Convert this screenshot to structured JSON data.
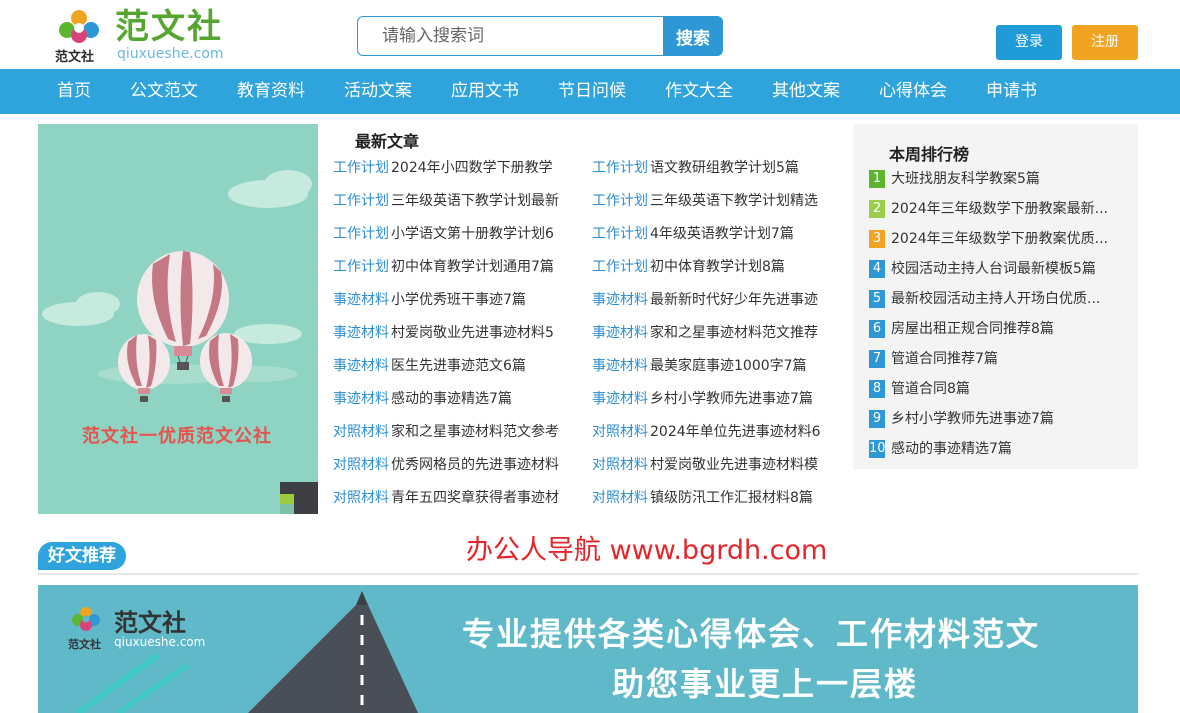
{
  "header": {
    "logo_cn": "范文社",
    "logo_small": "范文社",
    "logo_en": "qiuxueshe.com",
    "search_placeholder": "请输入搜索词",
    "search_btn": "搜索",
    "login": "登录",
    "register": "注册"
  },
  "nav": [
    "首页",
    "公文范文",
    "教育资料",
    "活动文案",
    "应用文书",
    "节日问候",
    "作文大全",
    "其他文案",
    "心得体会",
    "申请书"
  ],
  "hero": {
    "caption": "范文社一优质范文公社"
  },
  "latest": {
    "title": "最新文章",
    "left": [
      {
        "cat": "工作计划",
        "title": "2024年小四数学下册教学"
      },
      {
        "cat": "工作计划",
        "title": "三年级英语下教学计划最新"
      },
      {
        "cat": "工作计划",
        "title": "小学语文第十册教学计划6"
      },
      {
        "cat": "工作计划",
        "title": "初中体育教学计划通用7篇"
      },
      {
        "cat": "事迹材料",
        "title": "小学优秀班干事迹7篇"
      },
      {
        "cat": "事迹材料",
        "title": "村爱岗敬业先进事迹材料5"
      },
      {
        "cat": "事迹材料",
        "title": "医生先进事迹范文6篇"
      },
      {
        "cat": "事迹材料",
        "title": "感动的事迹精选7篇"
      },
      {
        "cat": "对照材料",
        "title": "家和之星事迹材料范文参考"
      },
      {
        "cat": "对照材料",
        "title": "优秀网格员的先进事迹材料"
      },
      {
        "cat": "对照材料",
        "title": "青年五四奖章获得者事迹材"
      }
    ],
    "right": [
      {
        "cat": "工作计划",
        "title": "语文教研组教学计划5篇"
      },
      {
        "cat": "工作计划",
        "title": "三年级英语下教学计划精选"
      },
      {
        "cat": "工作计划",
        "title": "4年级英语教学计划7篇"
      },
      {
        "cat": "工作计划",
        "title": "初中体育教学计划8篇"
      },
      {
        "cat": "事迹材料",
        "title": "最新新时代好少年先进事迹"
      },
      {
        "cat": "事迹材料",
        "title": "家和之星事迹材料范文推荐"
      },
      {
        "cat": "事迹材料",
        "title": "最美家庭事迹1000字7篇"
      },
      {
        "cat": "事迹材料",
        "title": "乡村小学教师先进事迹7篇"
      },
      {
        "cat": "对照材料",
        "title": "2024年单位先进事迹材料6"
      },
      {
        "cat": "对照材料",
        "title": "村爱岗敬业先进事迹材料模"
      },
      {
        "cat": "对照材料",
        "title": "镇级防汛工作汇报材料8篇"
      }
    ]
  },
  "rank": {
    "title": "本周排行榜",
    "items": [
      {
        "num": "1",
        "title": "大班找朋友科学教案5篇",
        "color": "#5bb531"
      },
      {
        "num": "2",
        "title": "2024年三年级数学下册教案最新...",
        "color": "#9ccd4a"
      },
      {
        "num": "3",
        "title": "2024年三年级数学下册教案优质...",
        "color": "#f0a422"
      },
      {
        "num": "4",
        "title": "校园活动主持人台词最新模板5篇",
        "color": "#2e97d6"
      },
      {
        "num": "5",
        "title": "最新校园活动主持人开场白优质...",
        "color": "#2e97d6"
      },
      {
        "num": "6",
        "title": "房屋出租正规合同推荐8篇",
        "color": "#2e97d6"
      },
      {
        "num": "7",
        "title": "管道合同推荐7篇",
        "color": "#2e97d6"
      },
      {
        "num": "8",
        "title": "管道合同8篇",
        "color": "#2e97d6"
      },
      {
        "num": "9",
        "title": "乡村小学教师先进事迹7篇",
        "color": "#2e97d6"
      },
      {
        "num": "10",
        "title": "感动的事迹精选7篇",
        "color": "#2e97d6"
      }
    ]
  },
  "recommend": {
    "tag": "好文推荐",
    "watermark": "办公人导航 www.bgrdh.com"
  },
  "banner": {
    "logo_cn": "范文社",
    "logo_small": "范文社",
    "logo_en": "qiuxueshe.com",
    "line1": "专业提供各类心得体会、工作材料范文",
    "line2": "助您事业更上一层楼"
  }
}
